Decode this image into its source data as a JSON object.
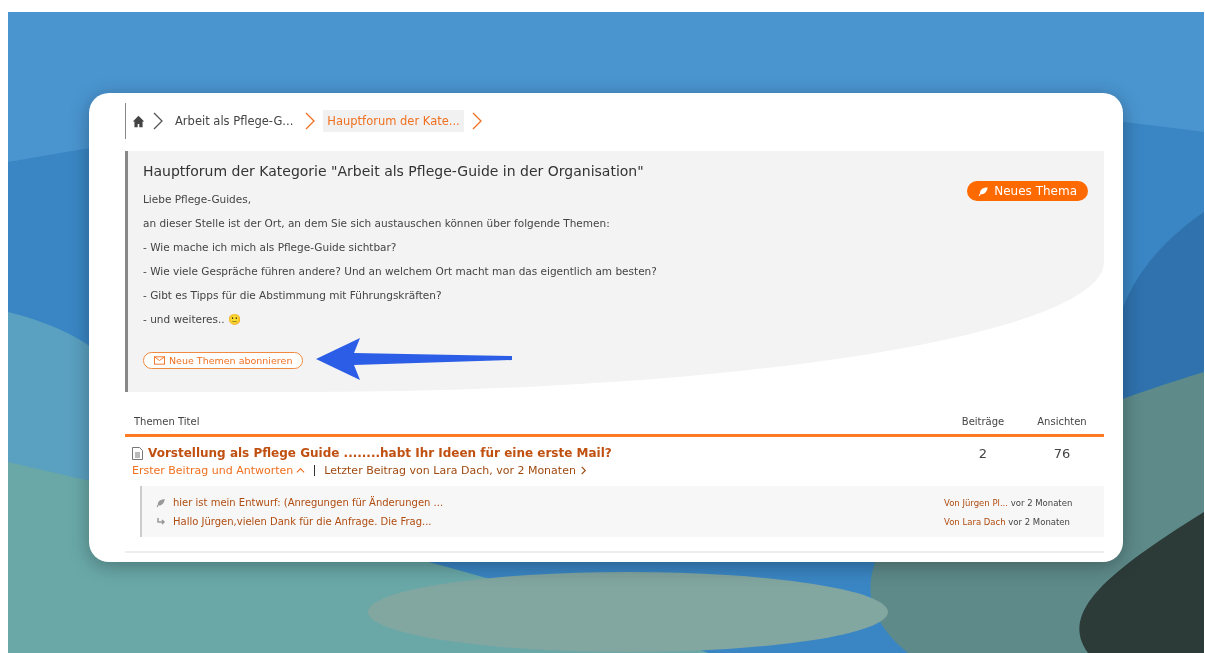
{
  "breadcrumb": [
    {
      "label": "Arbeit als Pflege-G...",
      "selected": false
    },
    {
      "label": "Hauptforum der Kate...",
      "selected": true
    }
  ],
  "category": {
    "title": "Hauptforum der Kategorie \"Arbeit als Pflege-Guide in der Organisation\"",
    "paragraphs": [
      "Liebe Pflege-Guides,",
      "an dieser Stelle ist der Ort, an dem Sie sich austauschen können über folgende Themen:",
      "- Wie mache ich mich als Pflege-Guide sichtbar?",
      "- Wie viele Gespräche führen andere? Und an welchem Ort macht man das eigentlich am besten?",
      "- Gibt es Tipps für die Abstimmung mit Führungskräften?",
      "- und weiteres.. 🙂"
    ],
    "new_topic_button": "Neues Thema",
    "subscribe_button": "Neue Themen abonnieren"
  },
  "table": {
    "columns": [
      "Themen Titel",
      "Beiträge",
      "Ansichten"
    ],
    "rows": [
      {
        "title": "Vorstellung als Pflege Guide ........habt Ihr Ideen für eine erste Mail?",
        "expand_link": "Erster Beitrag und Antworten",
        "expanded": true,
        "last_post": "Letzter Beitrag von Lara Dach, vor 2 Monaten",
        "posts": "2",
        "views": "76",
        "replies": [
          {
            "kind": "first",
            "text": "hier ist mein Entwurf: (Anregungen für Änderungen ...",
            "author": "Von Jürgen Pl...",
            "time": "vor 2 Monaten"
          },
          {
            "kind": "reply",
            "text": "Hallo Jürgen,vielen Dank für die Anfrage. Die Frag...",
            "author": "Von Lara Dach",
            "time": "vor 2 Monaten"
          }
        ]
      }
    ]
  }
}
